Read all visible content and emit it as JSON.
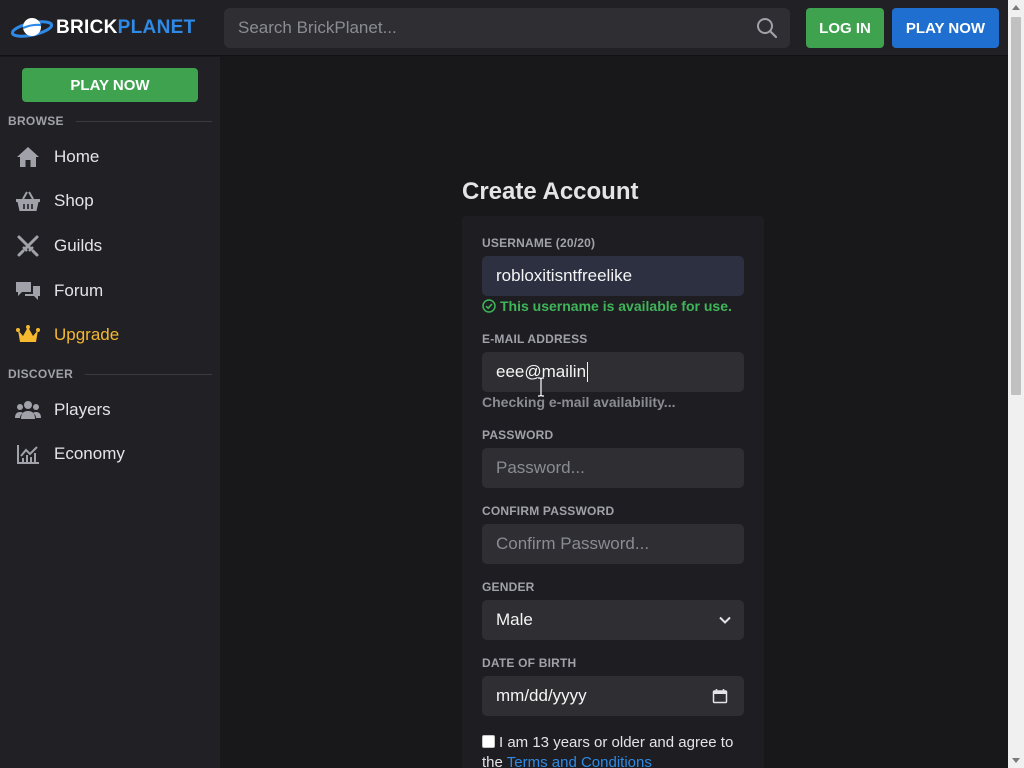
{
  "header": {
    "brand_part1": "BRICK",
    "brand_part2": "PLANET",
    "search_placeholder": "Search BrickPlanet...",
    "login_label": "LOG IN",
    "play_now_label": "PLAY NOW"
  },
  "sidebar": {
    "play_now_label": "PLAY NOW",
    "browse_heading": "BROWSE",
    "discover_heading": "DISCOVER",
    "browse_items": [
      {
        "label": "Home",
        "icon": "home-icon"
      },
      {
        "label": "Shop",
        "icon": "basket-icon"
      },
      {
        "label": "Guilds",
        "icon": "crossed-swords-icon"
      },
      {
        "label": "Forum",
        "icon": "chat-bubbles-icon"
      },
      {
        "label": "Upgrade",
        "icon": "crown-icon"
      }
    ],
    "discover_items": [
      {
        "label": "Players",
        "icon": "users-icon"
      },
      {
        "label": "Economy",
        "icon": "chart-icon"
      }
    ]
  },
  "form": {
    "title": "Create Account",
    "username": {
      "label": "USERNAME (20/20)",
      "value": "robloxitisntfreelike",
      "status": "This username is available for use."
    },
    "email": {
      "label": "E-MAIL ADDRESS",
      "value": "eee@mailin",
      "status": "Checking e-mail availability..."
    },
    "password": {
      "label": "PASSWORD",
      "placeholder": "Password..."
    },
    "confirm_password": {
      "label": "CONFIRM PASSWORD",
      "placeholder": "Confirm Password..."
    },
    "gender": {
      "label": "GENDER",
      "selected": "Male"
    },
    "dob": {
      "label": "DATE OF BIRTH",
      "placeholder": "mm/dd/yyyy"
    },
    "agree": {
      "text": "I am 13 years or older and agree to the",
      "link": "Terms and Conditions"
    }
  },
  "colors": {
    "accent_green": "#3fa24f",
    "accent_blue": "#1f6fd0",
    "upgrade_gold": "#f5b82e",
    "success": "#3fb55a"
  }
}
